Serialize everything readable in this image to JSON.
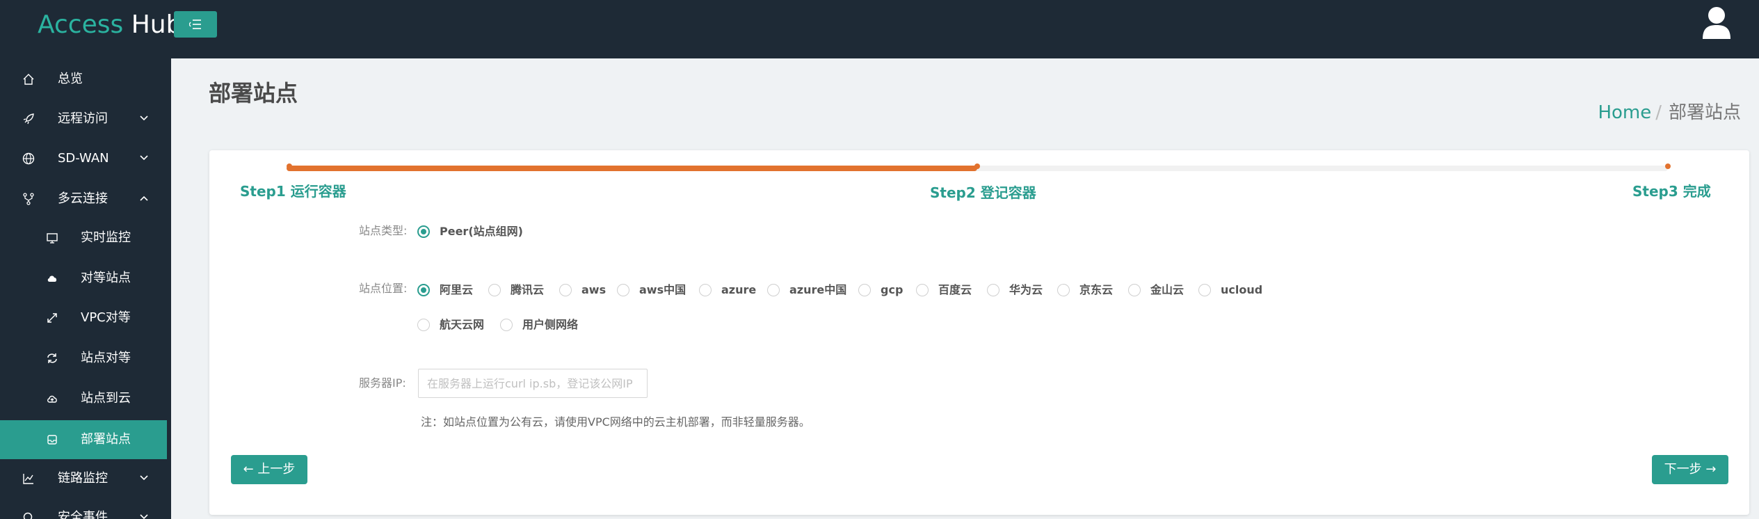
{
  "header": {
    "brand_part1": "Access",
    "brand_part2": "Hub",
    "menu_toggle_icon": "menu-collapse-icon",
    "user_icon": "user-icon"
  },
  "sidebar": {
    "items": [
      {
        "label": "总览",
        "icon": "home-icon"
      },
      {
        "label": "远程访问",
        "icon": "rocket-icon",
        "expanded": false
      },
      {
        "label": "SD-WAN",
        "icon": "globe-icon",
        "expanded": false
      },
      {
        "label": "多云连接",
        "icon": "branch-icon",
        "expanded": true
      },
      {
        "label": "实时监控",
        "icon": "monitor-icon",
        "sub": true
      },
      {
        "label": "对等站点",
        "icon": "cloud-icon",
        "sub": true
      },
      {
        "label": "VPC对等",
        "icon": "expand-icon",
        "sub": true
      },
      {
        "label": "站点对等",
        "icon": "sync-icon",
        "sub": true
      },
      {
        "label": "站点到云",
        "icon": "cloud-upload-icon",
        "sub": true
      },
      {
        "label": "部署站点",
        "icon": "deploy-icon",
        "sub": true,
        "active": true
      },
      {
        "label": "链路监控",
        "icon": "line-chart-icon",
        "expanded": false
      },
      {
        "label": "安全事件",
        "icon": "search-icon",
        "expanded": false
      }
    ]
  },
  "page": {
    "title": "部署站点",
    "breadcrumb": {
      "home": "Home",
      "separator": "/",
      "current": "部署站点"
    }
  },
  "wizard": {
    "progress": 0.5,
    "steps": [
      "Step1 运行容器",
      "Step2 登记容器",
      "Step3 完成"
    ],
    "current_step": 2
  },
  "form": {
    "site_type": {
      "label": "站点类型:",
      "options": [
        "Peer(站点组网)"
      ],
      "selected": "Peer(站点组网)"
    },
    "site_location": {
      "label": "站点位置:",
      "options": [
        "阿里云",
        "腾讯云",
        "aws",
        "aws中国",
        "azure",
        "azure中国",
        "gcp",
        "百度云",
        "华为云",
        "京东云",
        "金山云",
        "ucloud",
        "航天云网",
        "用户侧网络"
      ],
      "selected": "阿里云"
    },
    "server_ip": {
      "label": "服务器IP:",
      "value": "",
      "placeholder": "在服务器上运行curl ip.sb，登记该公网IP"
    },
    "note": "注：如站点位置为公有云，请使用VPC网络中的云主机部署，而非轻量服务器。"
  },
  "buttons": {
    "prev": "← 上一步",
    "next": "下一步 →"
  },
  "colors": {
    "header_bg": "#1e2a36",
    "accent": "#2a9d8f",
    "progress": "#e2722e",
    "page_bg": "#eff2f4"
  }
}
